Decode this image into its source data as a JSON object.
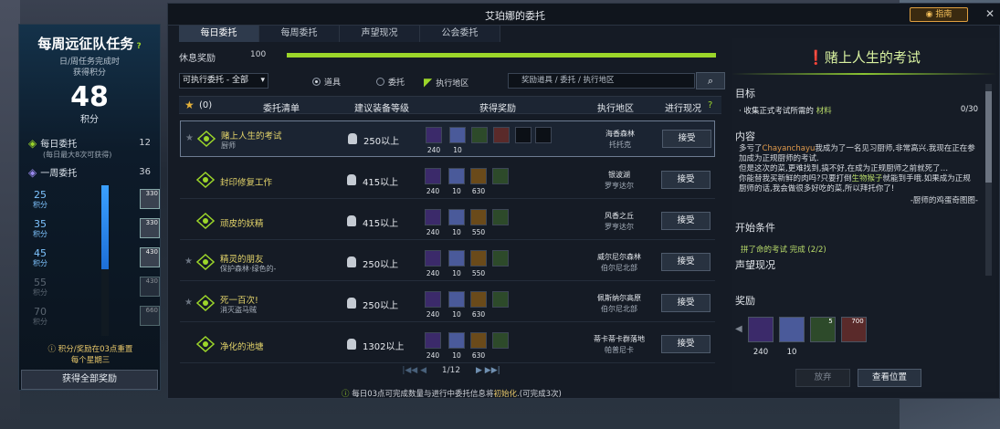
{
  "left_panel": {
    "title": "每周远征队任务",
    "subtitle_line1": "日/周任务完成时",
    "subtitle_line2": "获得积分",
    "points": "48",
    "points_unit": "积分",
    "daily_label": "每日委托",
    "daily_value": "12",
    "daily_sub": "(每日最大8次可获得)",
    "weekly_label": "一周委托",
    "weekly_value": "36",
    "milestones": [
      {
        "value": "25",
        "unit": "积分",
        "item": "330"
      },
      {
        "value": "35",
        "unit": "积分",
        "item": "330"
      },
      {
        "value": "45",
        "unit": "积分",
        "item": "430"
      },
      {
        "value": "55",
        "unit": "积分",
        "item": "430"
      },
      {
        "value": "70",
        "unit": "积分",
        "item": "660"
      }
    ],
    "progress_fraction": 0.56,
    "reset_note_line1": "积分/奖励在03点重置",
    "reset_note_line2": "每个星期三",
    "claim_button": "获得全部奖励"
  },
  "window": {
    "title": "艾珀娜的委托",
    "guide_button": "指南",
    "close": "✕"
  },
  "tabs": [
    {
      "label": "每日委托",
      "active": true
    },
    {
      "label": "每周委托",
      "active": false
    },
    {
      "label": "声望现况",
      "active": false
    },
    {
      "label": "公会委托",
      "active": false
    }
  ],
  "rest": {
    "label": "休息奖励",
    "value": "100",
    "fraction": 1.0
  },
  "filters": {
    "select_value": "可执行委托 - 全部",
    "radio_items": "道具",
    "radio_quests": "委托",
    "radio_region": "执行地区",
    "search_placeholder": "奖励道具 / 委托 / 执行地区"
  },
  "table": {
    "col_fav_count": "(0)",
    "col_list": "委托清单",
    "col_level": "建议装备等级",
    "col_reward": "获得奖励",
    "col_region": "执行地区",
    "col_status": "进行现况"
  },
  "rows": [
    {
      "name": "赌上人生的考试",
      "sub": "厨师",
      "level": "250以上",
      "rewards": [
        "240",
        "10",
        "",
        "700"
      ],
      "region1": "海香森林",
      "region2": "托托克",
      "accept": "接受"
    },
    {
      "name": "封印修复工作",
      "sub": "",
      "level": "415以上",
      "rewards": [
        "240",
        "10",
        "630",
        ""
      ],
      "region1": "银波湖",
      "region2": "罗亨达尔",
      "accept": "接受"
    },
    {
      "name": "顽皮的妖精",
      "sub": "",
      "level": "415以上",
      "rewards": [
        "240",
        "10",
        "550",
        ""
      ],
      "region1": "风香之丘",
      "region2": "罗亨达尔",
      "accept": "接受"
    },
    {
      "name": "精灵的朋友",
      "sub": "保护森林·绿色的-",
      "level": "250以上",
      "rewards": [
        "240",
        "10",
        "550",
        ""
      ],
      "region1": "威尔尼尔森林",
      "region2": "伯尔尼北部",
      "accept": "接受"
    },
    {
      "name": "死一百次!",
      "sub": "消灭盗马贼",
      "level": "250以上",
      "rewards": [
        "240",
        "10",
        "630",
        ""
      ],
      "region1": "佩斯纳尔高原",
      "region2": "伯尔尼北部",
      "accept": "接受"
    },
    {
      "name": "净化的池塘",
      "sub": "",
      "level": "1302以上",
      "rewards": [
        "240",
        "10",
        "630",
        ""
      ],
      "region1": "蒂卡蒂卡群落地",
      "region2": "帕普尼卡",
      "accept": "接受"
    }
  ],
  "pager": {
    "text": "1/12"
  },
  "bottom_note": {
    "prefix": "每日03点可完成数量与进行中委托信息将",
    "highlight": "初始化",
    "suffix": ".(可完成3次)"
  },
  "detail": {
    "title": "赌上人生的考试",
    "objective_header": "目标",
    "objective_prefix": "· 收集正式考试所需的 ",
    "objective_item": "材料",
    "objective_count": "0/30",
    "content_header": "内容",
    "content_name": "Chayanchayu",
    "content_l1a": "多亏了",
    "content_l1b": "我成为了一名见习厨师,非常高兴.我现在正在参加成为正规厨师的考试.",
    "content_l2": "但是这次的菜,更难找到,搞不好,在成为正规厨师之前就死了…",
    "content_l3a": "你能替我买新鲜的肉吗?只要打倒",
    "content_l3b": "生物猴子",
    "content_l3c": "就能到手哦.如果成为正规厨师的话,我会做很多好吃的菜,所以拜托你了!",
    "signature": "-厨师的鸡蛋奇图图-",
    "start_header": "开始条件",
    "start_cond": "拼了命的考试 完成 (2/2)",
    "rep_header": "声望现况",
    "reward_header": "奖励",
    "reward_counts": [
      "240",
      "10",
      "",
      ""
    ],
    "reward_badge_3": "5",
    "reward_badge_4": "700",
    "abandon": "放弃",
    "view_location": "查看位置"
  }
}
